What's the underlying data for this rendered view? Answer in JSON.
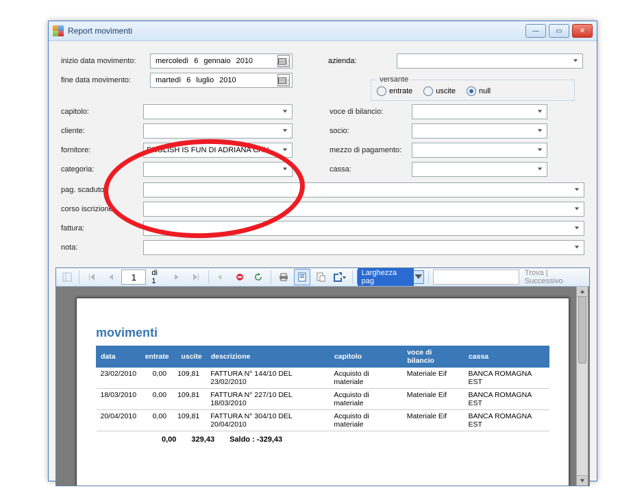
{
  "window": {
    "title": "Report movimenti"
  },
  "filters": {
    "inizio_label": "inizio data movimento:",
    "fine_label": "fine data movimento:",
    "inizio_date": {
      "dow": "mercoledì",
      "d": "6",
      "m": "gennaio",
      "y": "2010"
    },
    "fine_date": {
      "dow": "martedì",
      "d": "6",
      "m": "luglio",
      "y": "2010"
    },
    "azienda_label": "azienda:",
    "versante_legend": "versante",
    "versante_options": {
      "entrate": "entrate",
      "uscite": "uscite",
      "null": "null"
    },
    "versante_selected": "null",
    "capitolo_label": "capitolo:",
    "cliente_label": "cliente:",
    "fornitore_label": "fornitore:",
    "fornitore_value": "ENGLISH IS FUN DI ADRIANA CAN",
    "categoria_label": "categoria:",
    "voce_label": "voce di bilancio:",
    "socio_label": "socio:",
    "mezzo_label": "mezzo di pagamento:",
    "cassa_label": "cassa:",
    "pag_label": "pag. scaduto:",
    "corso_label": "corso iscrizione:",
    "fattura_label": "fattura:",
    "nota_label": "nota:"
  },
  "viewer": {
    "page_current": "1",
    "page_of": "di  1",
    "zoom_label": "Larghezza pag",
    "find_label": "Trova",
    "next_label": "Successivo",
    "find_sep": "|"
  },
  "report": {
    "title": "movimenti",
    "cols": {
      "data": "data",
      "entrate": "entrate",
      "uscite": "uscite",
      "descrizione": "descrizione",
      "capitolo": "capitolo",
      "voce": "voce di bilancio",
      "cassa": "cassa"
    },
    "rows": [
      {
        "data": "23/02/2010",
        "entrate": "0,00",
        "uscite": "109,81",
        "descrizione": "FATTURA N° 144/10 DEL 23/02/2010",
        "capitolo": "Acquisto di materiale",
        "voce": "Materiale Eif",
        "cassa": "BANCA ROMAGNA EST"
      },
      {
        "data": "18/03/2010",
        "entrate": "0,00",
        "uscite": "109,81",
        "descrizione": "FATTURA N° 227/10 DEL 18/03/2010",
        "capitolo": "Acquisto di materiale",
        "voce": "Materiale Eif",
        "cassa": "BANCA ROMAGNA EST"
      },
      {
        "data": "20/04/2010",
        "entrate": "0,00",
        "uscite": "109,81",
        "descrizione": "FATTURA N° 304/10 DEL 20/04/2010",
        "capitolo": "Acquisto di materiale",
        "voce": "Materiale Eif",
        "cassa": "BANCA ROMAGNA EST"
      }
    ],
    "tot_entrate": "0,00",
    "tot_uscite": "329,43",
    "saldo_label": "Saldo : -329,43"
  }
}
